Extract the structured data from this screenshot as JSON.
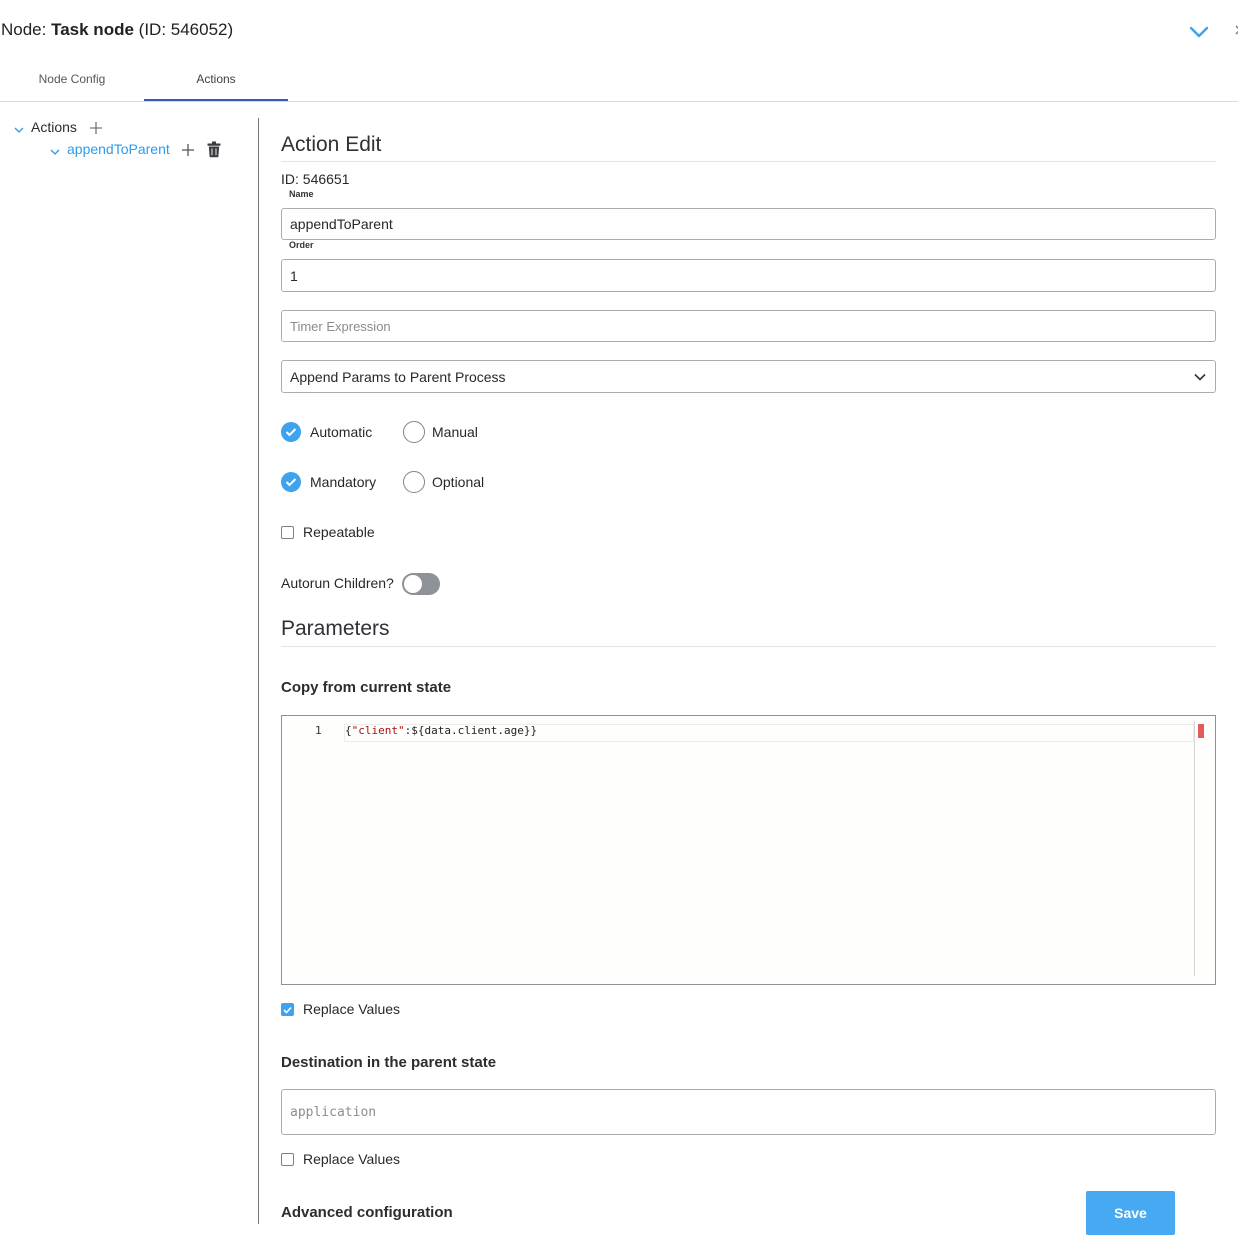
{
  "header": {
    "prefix": "Node: ",
    "node_name": "Task node",
    "id_text": "(ID: 546052)"
  },
  "tabs": [
    {
      "label": "Node Config",
      "active": false
    },
    {
      "label": "Actions",
      "active": true
    }
  ],
  "tree": {
    "root_label": "Actions",
    "child_label": "appendToParent"
  },
  "action_edit": {
    "title": "Action Edit",
    "id_text": "ID: 546651",
    "name_label": "Name",
    "name_value": "appendToParent",
    "order_label": "Order",
    "order_value": "1",
    "timer_placeholder": "Timer Expression",
    "action_type": "Append Params to Parent Process",
    "trigger_options": [
      {
        "label": "Automatic",
        "selected": true
      },
      {
        "label": "Manual",
        "selected": false
      }
    ],
    "requirement_options": [
      {
        "label": "Mandatory",
        "selected": true
      },
      {
        "label": "Optional",
        "selected": false
      }
    ],
    "repeatable_label": "Repeatable",
    "repeatable_checked": false,
    "autorun_label": "Autorun Children?",
    "autorun_on": false
  },
  "parameters": {
    "title": "Parameters",
    "copy_heading": "Copy from current state",
    "editor": {
      "line_number": "1",
      "code_prefix": "{",
      "code_string": "\"client\"",
      "code_rest": ":${data.client.age}}"
    },
    "replace_values_1_label": "Replace Values",
    "replace_values_1_checked": true,
    "destination_heading": "Destination in the parent state",
    "destination_placeholder": "application",
    "replace_values_2_label": "Replace Values",
    "replace_values_2_checked": false,
    "advanced_heading": "Advanced configuration"
  },
  "buttons": {
    "save_label": "Save"
  },
  "colors": {
    "accent": "#3ea3ef",
    "save_button": "#46a9f1",
    "tree_link": "#2f9be8",
    "tab_underline": "#3559b5",
    "error_marker": "#e45b5b"
  },
  "icons": [
    "chevron-down-icon",
    "close-icon",
    "plus-icon",
    "trash-icon",
    "check-icon"
  ]
}
